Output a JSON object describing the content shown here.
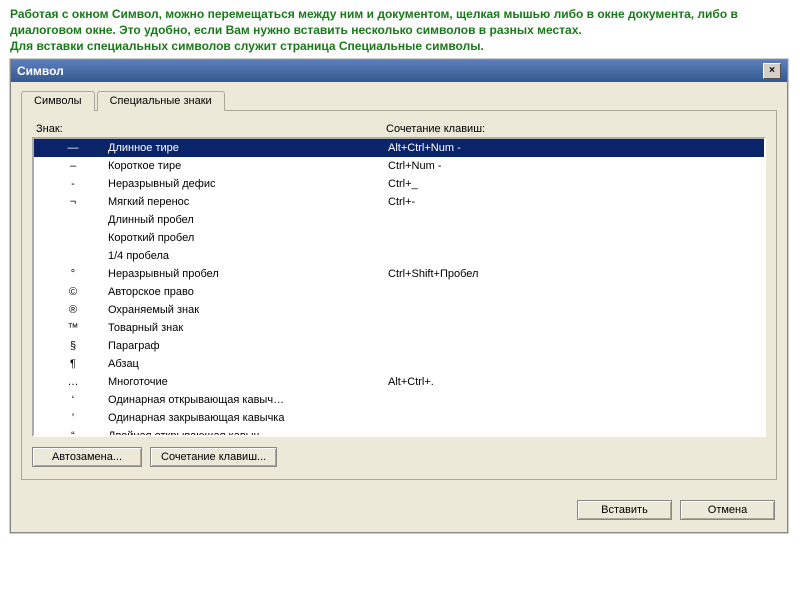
{
  "intro": {
    "line1": "Работая с окном Символ, можно перемещаться между ним и документом, щелкая мышью либо в окне документа, либо в диалоговом окне. Это удобно, если Вам нужно вставить несколько символов в разных местах.",
    "line2": "Для вставки специальных символов служит страница Специальные символы."
  },
  "dialog": {
    "title": "Символ",
    "close_x": "×"
  },
  "tabs": {
    "symbols": "Символы",
    "special": "Специальные знаки"
  },
  "headers": {
    "sign": "Знак:",
    "shortcut": "Сочетание клавиш:"
  },
  "rows": [
    {
      "sym": "—",
      "name": "Длинное тире",
      "key": "Alt+Ctrl+Num -",
      "selected": true
    },
    {
      "sym": "–",
      "name": "Короткое тире",
      "key": "Ctrl+Num -"
    },
    {
      "sym": "-",
      "name": "Неразрывный дефис",
      "key": "Ctrl+_"
    },
    {
      "sym": "¬",
      "name": "Мягкий перенос",
      "key": "Ctrl+-"
    },
    {
      "sym": "",
      "name": "Длинный пробел",
      "key": ""
    },
    {
      "sym": "",
      "name": "Короткий пробел",
      "key": ""
    },
    {
      "sym": "",
      "name": "1/4 пробела",
      "key": ""
    },
    {
      "sym": "°",
      "name": "Неразрывный пробел",
      "key": "Ctrl+Shift+Пробел"
    },
    {
      "sym": "©",
      "name": "Авторское право",
      "key": ""
    },
    {
      "sym": "®",
      "name": "Охраняемый знак",
      "key": ""
    },
    {
      "sym": "™",
      "name": "Товарный знак",
      "key": ""
    },
    {
      "sym": "§",
      "name": "Параграф",
      "key": ""
    },
    {
      "sym": "¶",
      "name": "Абзац",
      "key": ""
    },
    {
      "sym": "…",
      "name": "Многоточие",
      "key": "Alt+Ctrl+."
    },
    {
      "sym": "‘",
      "name": "Одинарная открывающая кавыч…",
      "key": ""
    },
    {
      "sym": "’",
      "name": "Одинарная закрывающая кавычка",
      "key": ""
    },
    {
      "sym": "“",
      "name": "Двойная открывающая кавыч…",
      "key": ""
    }
  ],
  "buttons": {
    "autocorrect": "Автозамена...",
    "shortcut": "Сочетание клавиш...",
    "insert": "Вставить",
    "cancel": "Отмена"
  }
}
